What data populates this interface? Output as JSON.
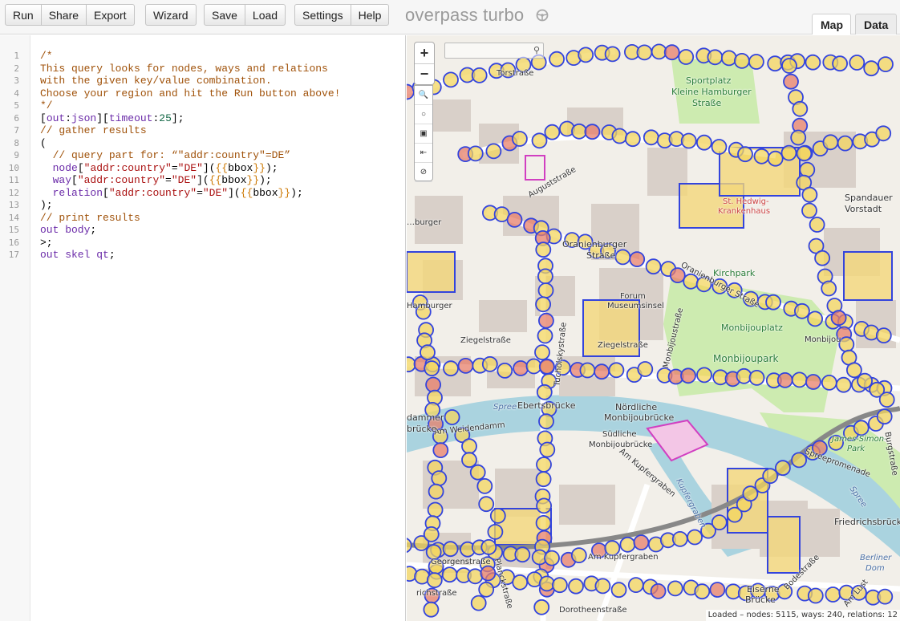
{
  "toolbar": {
    "run": "Run",
    "share": "Share",
    "export": "Export",
    "wizard": "Wizard",
    "save": "Save",
    "load": "Load",
    "settings": "Settings",
    "help": "Help"
  },
  "app_title": "overpass turbo",
  "tabs": {
    "map": "Map",
    "data": "Data"
  },
  "editor": {
    "line_numbers": [
      "1",
      "2",
      "3",
      "4",
      "5",
      "6",
      "7",
      "8",
      "9",
      "10",
      "11",
      "12",
      "13",
      "14",
      "15",
      "16",
      "17"
    ],
    "lines": [
      [
        {
          "t": "comment",
          "v": "/*"
        }
      ],
      [
        {
          "t": "comment",
          "v": "This query looks for nodes, ways and relations"
        }
      ],
      [
        {
          "t": "comment",
          "v": "with the given key/value combination."
        }
      ],
      [
        {
          "t": "comment",
          "v": "Choose your region and hit the Run button above!"
        }
      ],
      [
        {
          "t": "comment",
          "v": "*/"
        }
      ],
      [
        {
          "t": "plain",
          "v": "["
        },
        {
          "t": "keyword",
          "v": "out"
        },
        {
          "t": "plain",
          "v": ":"
        },
        {
          "t": "keyword",
          "v": "json"
        },
        {
          "t": "plain",
          "v": "]["
        },
        {
          "t": "keyword",
          "v": "timeout"
        },
        {
          "t": "plain",
          "v": ":"
        },
        {
          "t": "number",
          "v": "25"
        },
        {
          "t": "plain",
          "v": "];"
        }
      ],
      [
        {
          "t": "comment",
          "v": "// gather results"
        }
      ],
      [
        {
          "t": "plain",
          "v": "("
        }
      ],
      [
        {
          "t": "comment",
          "v": "  // query part for: “\"addr:country\"=DE”"
        }
      ],
      [
        {
          "t": "plain",
          "v": "  "
        },
        {
          "t": "keyword",
          "v": "node"
        },
        {
          "t": "plain",
          "v": "["
        },
        {
          "t": "string",
          "v": "\"addr:country\""
        },
        {
          "t": "plain",
          "v": "="
        },
        {
          "t": "string",
          "v": "\"DE\""
        },
        {
          "t": "plain",
          "v": "]("
        },
        {
          "t": "brace",
          "v": "{{"
        },
        {
          "t": "plain",
          "v": "bbox"
        },
        {
          "t": "brace",
          "v": "}}"
        },
        {
          "t": "plain",
          "v": ");"
        }
      ],
      [
        {
          "t": "plain",
          "v": "  "
        },
        {
          "t": "keyword",
          "v": "way"
        },
        {
          "t": "plain",
          "v": "["
        },
        {
          "t": "string",
          "v": "\"addr:country\""
        },
        {
          "t": "plain",
          "v": "="
        },
        {
          "t": "string",
          "v": "\"DE\""
        },
        {
          "t": "plain",
          "v": "]("
        },
        {
          "t": "brace",
          "v": "{{"
        },
        {
          "t": "plain",
          "v": "bbox"
        },
        {
          "t": "brace",
          "v": "}}"
        },
        {
          "t": "plain",
          "v": ");"
        }
      ],
      [
        {
          "t": "plain",
          "v": "  "
        },
        {
          "t": "keyword",
          "v": "relation"
        },
        {
          "t": "plain",
          "v": "["
        },
        {
          "t": "string",
          "v": "\"addr:country\""
        },
        {
          "t": "plain",
          "v": "="
        },
        {
          "t": "string",
          "v": "\"DE\""
        },
        {
          "t": "plain",
          "v": "]("
        },
        {
          "t": "brace",
          "v": "{{"
        },
        {
          "t": "plain",
          "v": "bbox"
        },
        {
          "t": "brace",
          "v": "}}"
        },
        {
          "t": "plain",
          "v": ");"
        }
      ],
      [
        {
          "t": "plain",
          "v": ");"
        }
      ],
      [
        {
          "t": "comment",
          "v": "// print results"
        }
      ],
      [
        {
          "t": "keyword",
          "v": "out body"
        },
        {
          "t": "plain",
          "v": ";"
        }
      ],
      [
        {
          "t": "plain",
          "v": ">;"
        }
      ],
      [
        {
          "t": "keyword",
          "v": "out skel qt"
        },
        {
          "t": "plain",
          "v": ";"
        }
      ]
    ]
  },
  "map": {
    "zoom_in": "+",
    "zoom_out": "−",
    "labels": {
      "torstrasse": "Torstraße",
      "sportplatz": "Sportplatz",
      "kleine_hamburger": "Kleine Hamburger",
      "strasse": "Straße",
      "auguststrasse": "Auguststraße",
      "oranienburger_1": "Oranienburger",
      "oranienburger_2": "Straße",
      "oranienburger_str": "Oranienburger Straße",
      "forum": "Forum",
      "museumsinsel": "Museumsinsel",
      "ziegelstrasse_1": "Ziegelstraße",
      "ziegelstrasse_2": "Ziegelstraße",
      "monbijouplatz": "Monbijouplatz",
      "monbijoupark": "Monbijoupark",
      "monbijou_label": "Monbijou",
      "ebertsbruecke": "Ebertsbrücke",
      "noerdliche": "Nördliche",
      "monbijou_n": "Monbijoubrücke",
      "suedliche": "Südliche",
      "monbijou_s": "Monbijoubrücke",
      "spree_1": "Spree",
      "spree_2": "Spree",
      "am_weidendamm": "Am Weidendamm",
      "am_kupfergraben": "Am Kupfergraben",
      "james_simon": "James-Simon-",
      "park": "Park",
      "spreepromenade": "Spreepromenade",
      "friedrichsbruecke": "Friedrichsbrücke",
      "berliner": "Berliner",
      "dom": "Dom",
      "eiserne": "Eiserne",
      "bruecke": "Brücke",
      "bodestrasse": "Bodestraße",
      "am_lust": "Am Lust",
      "georgenstrasse": "Georgenstraße",
      "planckstrasse": "Planckstraße",
      "dorotheenstrasse": "Dorotheenstraße",
      "tucholskystrasse": "Tucholskystraße",
      "st_hedwig": "St. Hedwig-",
      "krankenhaus": "Krankenhaus",
      "spandauer_1": "Spandauer",
      "spandauer_2": "Vorstadt",
      "burgstrasse": "Burgstraße",
      "monbijoustr": "Monbijoustraße",
      "kupfergraben_water": "Kupfergraben",
      "am_kupfergraben_2": "Am Kupfergraben",
      "hamburger_left": "Hamburger",
      "gammer": "dammer",
      "bruecke_left": "brücke",
      "richstrasse": "richstraße",
      "kirchpark": "Kirchpark",
      "anstrasse": "…burger"
    },
    "status": "Loaded – nodes: 5115, ways: 240, relations: 12",
    "colors": {
      "marker_stroke": "#3344dd",
      "marker_fill": "#f3d55f",
      "marker_red": "#e77f6a",
      "water": "#aad3df",
      "park": "#cdebb0",
      "building": "#d9d0c9"
    }
  }
}
